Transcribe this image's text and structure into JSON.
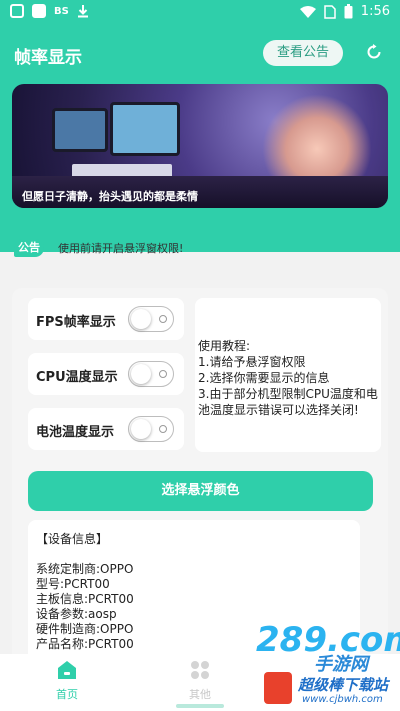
{
  "status_bar": {
    "left_text": "BS",
    "time": "1:56"
  },
  "header": {
    "title": "帧率显示",
    "notice_button": "查看公告"
  },
  "banner": {
    "caption": "但愿日子清静，抬头遇见的都是柔情"
  },
  "notice": {
    "tag": "公告",
    "text": "使用前请开启悬浮窗权限!"
  },
  "toggles": [
    {
      "label": "FPS帧率显示",
      "on": false
    },
    {
      "label": "CPU温度显示",
      "on": false
    },
    {
      "label": "电池温度显示",
      "on": false
    }
  ],
  "tutorial": {
    "lines": [
      "使用教程:",
      "1.请给予悬浮窗权限",
      "2.选择你需要显示的信息",
      "3.由于部分机型限制CPU温度和电池温度显示错误可以选择关闭!"
    ]
  },
  "color_button": "选择悬浮颜色",
  "device_info": {
    "title": "【设备信息】",
    "lines": [
      "系统定制商:OPPO",
      "型号:PCRT00",
      "主板信息:PCRT00",
      "设备参数:aosp",
      "硬件制造商:OPPO",
      "产品名称:PCRT00"
    ]
  },
  "bottom_nav": [
    {
      "label": "首页",
      "active": true
    },
    {
      "label": "其他",
      "active": false
    }
  ],
  "watermark": {
    "brand": "289.com",
    "sub": "手游网",
    "site": "超级棒下载站",
    "url": "www.cjbwh.com"
  },
  "colors": {
    "accent": "#2fcfaa",
    "background": "#f2f2f2"
  }
}
